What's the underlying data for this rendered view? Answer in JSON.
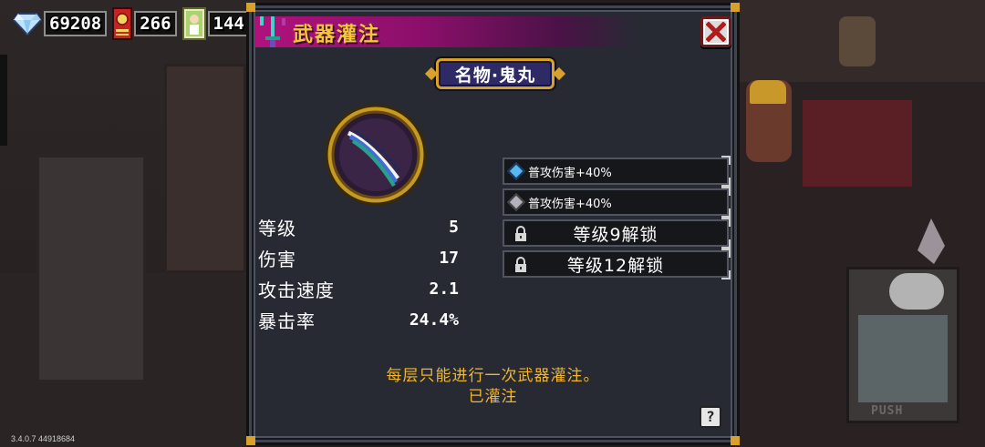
{
  "hud": {
    "gems": "69208",
    "coupons": "266",
    "cards": "144",
    "icons": [
      "diamond-icon",
      "red-coupon-icon",
      "character-card-icon"
    ]
  },
  "dialog": {
    "title": "武器灌注",
    "weapon_name": "名物·鬼丸",
    "stats": [
      {
        "label": "等级",
        "value": "5"
      },
      {
        "label": "伤害",
        "value": "17"
      },
      {
        "label": "攻击速度",
        "value": "2.1"
      },
      {
        "label": "暴击率",
        "value": "24.4%"
      }
    ],
    "enchantments": [
      {
        "text": "普攻伤害+40%",
        "state": "active",
        "icon": "blue-diamond-icon"
      },
      {
        "text": "普攻伤害+40%",
        "state": "active",
        "icon": "grey-diamond-icon"
      },
      {
        "text": "等级9解锁",
        "state": "locked",
        "icon": "lock-icon"
      },
      {
        "text": "等级12解锁",
        "state": "locked",
        "icon": "lock-icon"
      }
    ],
    "notice_line1": "每层只能进行一次武器灌注。",
    "notice_line2": "已灌注",
    "help_label": "?"
  },
  "background": {
    "push_label": "PUSH"
  },
  "version": "3.4.0.7 44918684",
  "colors": {
    "title_text": "#f6c637",
    "title_bar": "#b0127c",
    "notice_text": "#f0b72e",
    "panel_bg": "#272a33",
    "frame_gold": "#d8a12b"
  }
}
